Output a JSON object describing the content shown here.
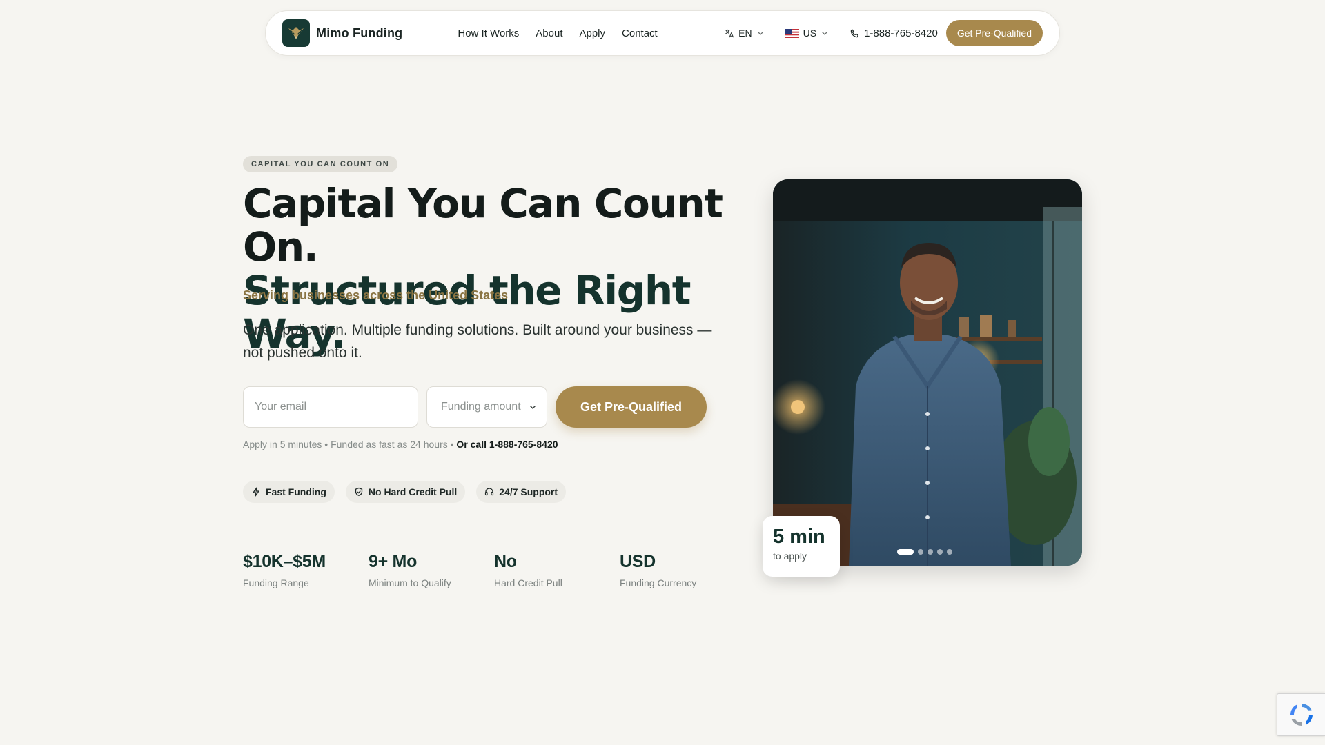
{
  "colors": {
    "accent_gold": "#a8894d",
    "brand_dark_green": "#173a34",
    "page_background": "#f6f5f1"
  },
  "nav": {
    "brand": "Mimo Funding",
    "logo_icon": "eagle-logo-icon",
    "links": [
      "How It Works",
      "About",
      "Apply",
      "Contact"
    ],
    "language": "EN",
    "region": "US",
    "phone": "1-888-765-8420",
    "cta": "Get Pre-Qualified"
  },
  "hero": {
    "eyebrow": "CAPITAL YOU CAN COUNT ON",
    "headline_line1": "Capital You Can Count On.",
    "headline_line2": "Structured the Right Way.",
    "subline": "Serving businesses across the United States",
    "lede": "One application. Multiple funding solutions. Built around your business — not pushed onto it.",
    "form": {
      "email_placeholder": "Your email",
      "amount_placeholder": "Funding amount",
      "cta": "Get Pre-Qualified"
    },
    "fine_print": "Apply in 5 minutes • Funded as fast as 24 hours •",
    "fine_print_call": "Or call 1-888-765-8420",
    "badges": [
      {
        "label": "Fast Funding",
        "icon": "lightning-icon"
      },
      {
        "label": "No Hard Credit Pull",
        "icon": "shield-check-icon"
      },
      {
        "label": "24/7 Support",
        "icon": "headset-icon"
      }
    ],
    "stats": [
      {
        "value": "$10K–$5M",
        "label": "Funding Range"
      },
      {
        "value": "9+ Mo",
        "label": "Minimum to Qualify"
      },
      {
        "value": "No",
        "label": "Hard Credit Pull"
      },
      {
        "value": "USD",
        "label": "Funding Currency"
      }
    ]
  },
  "carousel": {
    "slide_count": 5,
    "active_slide": 1
  },
  "apply_card": {
    "value": "5 min",
    "label": "to apply"
  }
}
